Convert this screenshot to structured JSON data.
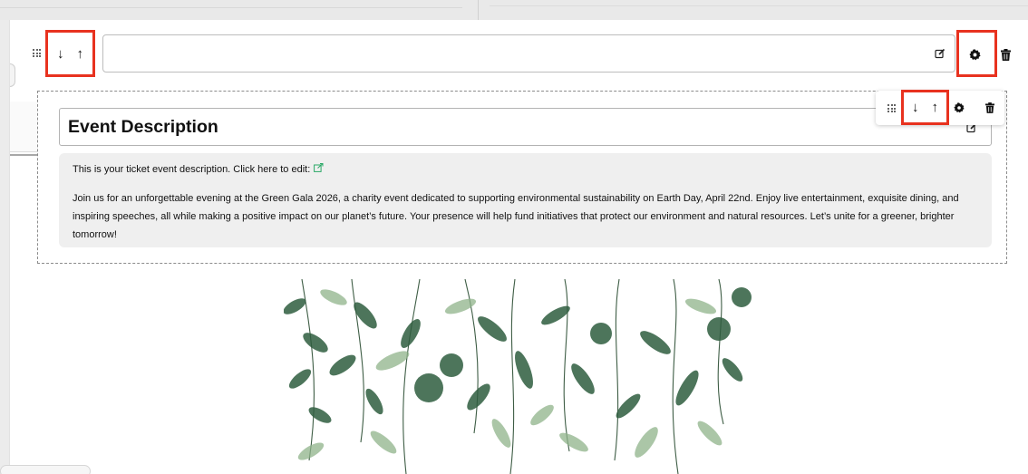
{
  "top_row": {
    "arrow_down": "↓",
    "arrow_up": "↑",
    "edit_icon": "edit-icon",
    "settings_icon": "gear-icon",
    "delete_icon": "trash-icon"
  },
  "event_block": {
    "title": "Event Description",
    "intro_text": "This is your ticket event description. Click here to edit:",
    "body_text": "Join us for an unforgettable evening at the Green Gala 2026, a charity event dedicated to supporting environmental sustainability on Earth Day, April 22nd. Enjoy live entertainment, exquisite dining, and inspiring speeches, all while making a positive impact on our planet’s future. Your presence will help fund initiatives that protect our environment and natural resources. Let’s unite for a greener, brighter tomorrow!",
    "link_icon": "external-link-icon"
  },
  "floating_toolbar": {
    "arrow_down": "↓",
    "arrow_up": "↑",
    "settings_icon": "gear-icon",
    "delete_icon": "trash-icon"
  },
  "image": {
    "description_icon": "eucalyptus-leaves-image"
  },
  "colors": {
    "highlight": "#e8321f",
    "link": "#2aa866",
    "leaf_dark": "#2f5d3f",
    "leaf_light": "#8fb38a"
  }
}
